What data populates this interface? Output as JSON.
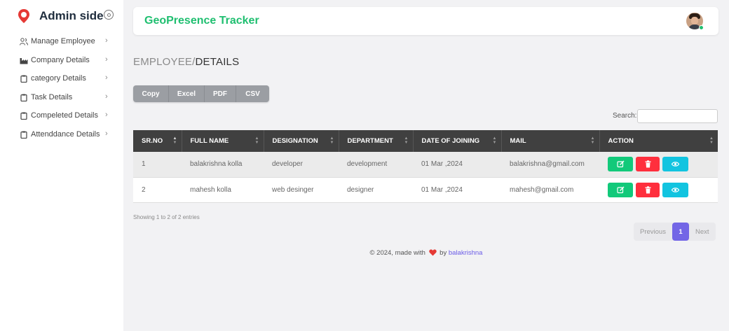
{
  "sidebar": {
    "title": "Admin side",
    "items": [
      {
        "label": "Manage Employee",
        "icon": "users-icon"
      },
      {
        "label": "Company Details",
        "icon": "factory-icon"
      },
      {
        "label": "category Details",
        "icon": "clipboard-icon"
      },
      {
        "label": "Task Details",
        "icon": "clipboard-icon"
      },
      {
        "label": "Compeleted Details",
        "icon": "clipboard-icon"
      },
      {
        "label": "Attenddance Details",
        "icon": "clipboard-icon"
      }
    ]
  },
  "header": {
    "app_title": "GeoPresence Tracker"
  },
  "breadcrumb": {
    "part1": "EMPLOYEE/",
    "part2": "DETAILS"
  },
  "export_buttons": [
    "Copy",
    "Excel",
    "PDF",
    "CSV"
  ],
  "search": {
    "label": "Search:",
    "value": ""
  },
  "table": {
    "columns": [
      "SR.NO",
      "FULL NAME",
      "DESIGNATION",
      "DEPARTMENT",
      "DATE OF JOINING",
      "MAIL",
      "ACTION"
    ],
    "rows": [
      [
        "1",
        "balakrishna kolla",
        "developer",
        "development",
        "01 Mar ,2024",
        "balakrishna@gmail.com"
      ],
      [
        "2",
        "mahesh kolla",
        "web desinger",
        "designer",
        "01 Mar ,2024",
        "mahesh@gmail.com"
      ]
    ]
  },
  "info": "Showing 1 to 2 of 2 entries",
  "pagination": {
    "previous": "Previous",
    "current": "1",
    "next": "Next"
  },
  "footer": {
    "prefix": "© 2024, made with",
    "middle": "by",
    "author": "balakrishna"
  },
  "colors": {
    "brand_green": "#1fbf70",
    "accent_purple": "#7366e6",
    "edit": "#12c97a",
    "delete": "#ff2f3d",
    "view": "#12c4e0",
    "logo_red": "#e53935"
  }
}
